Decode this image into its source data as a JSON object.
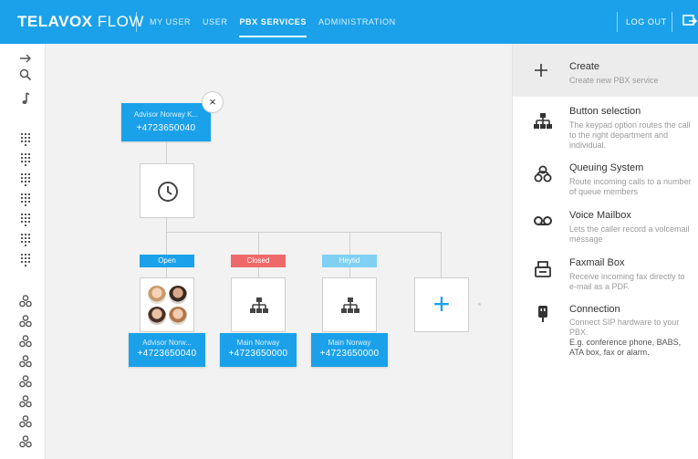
{
  "brand": {
    "bold": "TELAVOX",
    "light": "FLOW"
  },
  "nav": [
    "MY USER",
    "USER",
    "PBX SERVICES",
    "ADMINISTRATION"
  ],
  "logout": "LOG OUT",
  "flow": {
    "root": {
      "name": "Advisor Norway K...",
      "number": "+4723650040"
    },
    "close_label": "×",
    "tags": {
      "open": "Open",
      "closed": "Closed",
      "heytid": "Heytid"
    },
    "nodes": [
      {
        "name": "Advisor Norw...",
        "number": "+4723650040"
      },
      {
        "name": "Main Norway",
        "number": "+4723650000"
      },
      {
        "name": "Main Norway",
        "number": "+4723650000"
      }
    ],
    "add_label": "+"
  },
  "panel": {
    "create": {
      "title": "Create",
      "desc": "Create new PBX service"
    },
    "items": [
      {
        "title": "Button selection",
        "desc": "The keypad option routes the call to the right department and individual."
      },
      {
        "title": "Queuing System",
        "desc": "Route incoming calls to a number of queue members"
      },
      {
        "title": "Voice Mailbox",
        "desc": "Lets the caller record a volcemail message"
      },
      {
        "title": "Faxmail Box",
        "desc": "Receive incoming fax directly to e-mail as a PDF."
      },
      {
        "title": "Connection",
        "desc": "Connect SIP hardware to your PBX.",
        "desc2": "E.g. conference phone, BABS, ATA box, fax or alarm."
      }
    ]
  },
  "colors": {
    "brand_blue": "#1aa1ea",
    "open": "#1aa1ea",
    "closed": "#f0696a",
    "heytid": "#7fd0f3"
  },
  "icons": {
    "rail": [
      "arrow-right-icon",
      "search-icon",
      "music-note-icon",
      "keypad-icon",
      "queue-icon"
    ],
    "panel": [
      "plus-icon",
      "hierarchy-icon",
      "queue-icon",
      "voicemail-icon",
      "fax-icon",
      "plug-icon"
    ]
  }
}
